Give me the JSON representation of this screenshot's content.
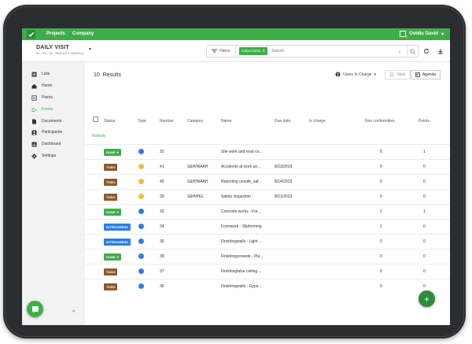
{
  "topbar": {
    "nav": [
      "Projects",
      "Company"
    ],
    "user": "Ovidiu David"
  },
  "visit": {
    "title": "DAILY VISIT",
    "subtitle": "02 - P5 - 02 - PROJECT SAMPLE"
  },
  "filter": {
    "filters_label": "Filters",
    "active_tag": "Active forms",
    "search_placeholder": "Search"
  },
  "sidebar": {
    "items": [
      {
        "label": "Lists",
        "icon": "list-icon"
      },
      {
        "label": "Home",
        "icon": "home-icon"
      },
      {
        "label": "Points",
        "icon": "points-icon"
      },
      {
        "label": "Forms",
        "icon": "forms-icon",
        "active": true
      },
      {
        "label": "Documents",
        "icon": "documents-icon"
      },
      {
        "label": "Participants",
        "icon": "participants-icon"
      },
      {
        "label": "Dashboard",
        "icon": "dashboard-icon"
      },
      {
        "label": "Settings",
        "icon": "gear-icon"
      }
    ]
  },
  "main": {
    "results_count": "10",
    "results_label": "Results",
    "users_in_charge": "Users In Charge",
    "view_table": "Table",
    "view_agenda": "Agenda",
    "group_label": "Nobody"
  },
  "table": {
    "headers": [
      "Status",
      "Type",
      "Number",
      "Category",
      "Name",
      "Due date",
      "In charge",
      "Non conformities",
      "Points"
    ],
    "rows": [
      {
        "status": "DONE",
        "type": "check",
        "number": "32",
        "category": "",
        "name": "Site work and road co...",
        "due": "",
        "nc": "8",
        "points": "1"
      },
      {
        "status": "TODO",
        "type": "warn",
        "number": "41",
        "category": "S&H/WAAH",
        "name": "Accidents at work an...",
        "due": "8/23/2019",
        "nc": "0",
        "points": "0"
      },
      {
        "status": "TODO",
        "type": "warn",
        "number": "40",
        "category": "S&H/WAAH",
        "name": "Reporting unsafe_saf...",
        "due": "8/14/2019",
        "nc": "0",
        "points": "0"
      },
      {
        "status": "TODO",
        "type": "warn",
        "number": "39",
        "category": "S&H/PEL",
        "name": "Safety inspection",
        "due": "8/21/2019",
        "nc": "0",
        "points": "0"
      },
      {
        "status": "DONE",
        "type": "check",
        "number": "33",
        "category": "",
        "name": "Concrete works - For...",
        "due": "",
        "nc": "2",
        "points": "1"
      },
      {
        "status": "IN PROGRESS",
        "type": "check",
        "number": "34",
        "category": "",
        "name": "Formwork - Slipforming",
        "due": "",
        "nc": "1",
        "points": "0"
      },
      {
        "status": "IN PROGRESS",
        "type": "check",
        "number": "35",
        "category": "",
        "name": "Finishingwalls - Light ...",
        "due": "",
        "nc": "0",
        "points": "0"
      },
      {
        "status": "DONE",
        "type": "check",
        "number": "38",
        "category": "",
        "name": "Finishingscreeds - Pla...",
        "due": "",
        "nc": "0",
        "points": "0"
      },
      {
        "status": "TODO",
        "type": "check",
        "number": "37",
        "category": "",
        "name": "Finishingfalse ceiling ...",
        "due": "",
        "nc": "0",
        "points": "0"
      },
      {
        "status": "TODO",
        "type": "check",
        "number": "36",
        "category": "",
        "name": "Finishingwalls - Gyps...",
        "due": "",
        "nc": "0",
        "points": "0"
      }
    ]
  },
  "colors": {
    "brand": "#3fae49",
    "todo": "#8b5a2b",
    "in_progress": "#2f7de1"
  }
}
